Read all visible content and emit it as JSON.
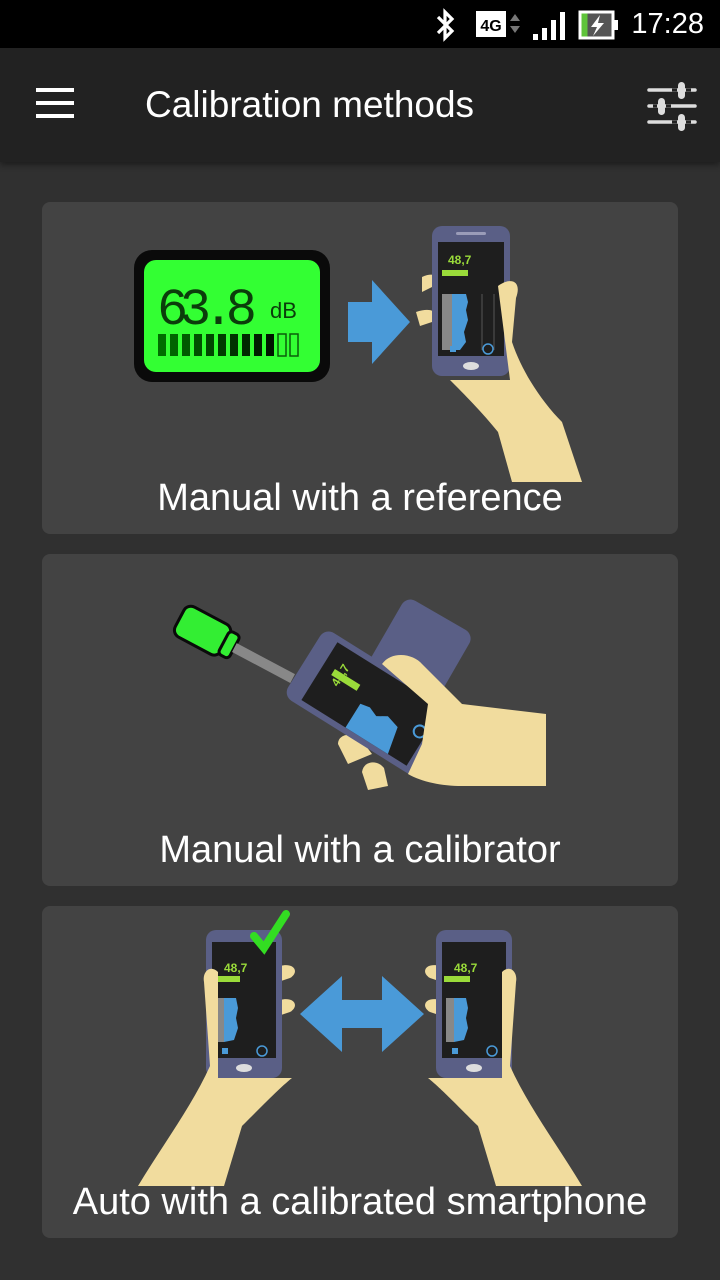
{
  "status_bar": {
    "time": "17:28",
    "network": "4G",
    "icons": [
      "bluetooth-icon",
      "4g-icon",
      "signal-icon",
      "battery-charging-icon"
    ]
  },
  "app_bar": {
    "title": "Calibration methods",
    "menu_icon": "hamburger-menu-icon",
    "action_icon": "tune-sliders-icon"
  },
  "methods": [
    {
      "label": "Manual with a reference",
      "illustration": {
        "meter_reading": "63.8",
        "meter_unit": "dB",
        "phone_reading": "48,7"
      }
    },
    {
      "label": "Manual with a calibrator",
      "illustration": {
        "phone_reading": "48,7"
      }
    },
    {
      "label": "Auto with a calibrated smartphone",
      "illustration": {
        "phone_reading_left": "48,7",
        "phone_reading_right": "48,7"
      }
    }
  ],
  "colors": {
    "background": "#303030",
    "app_bar": "#222222",
    "card": "#434343",
    "accent_blue": "#4a9ad8",
    "lcd_green": "#33ff33",
    "skin": "#f1dc9e",
    "phone_body": "#5a5f86"
  }
}
